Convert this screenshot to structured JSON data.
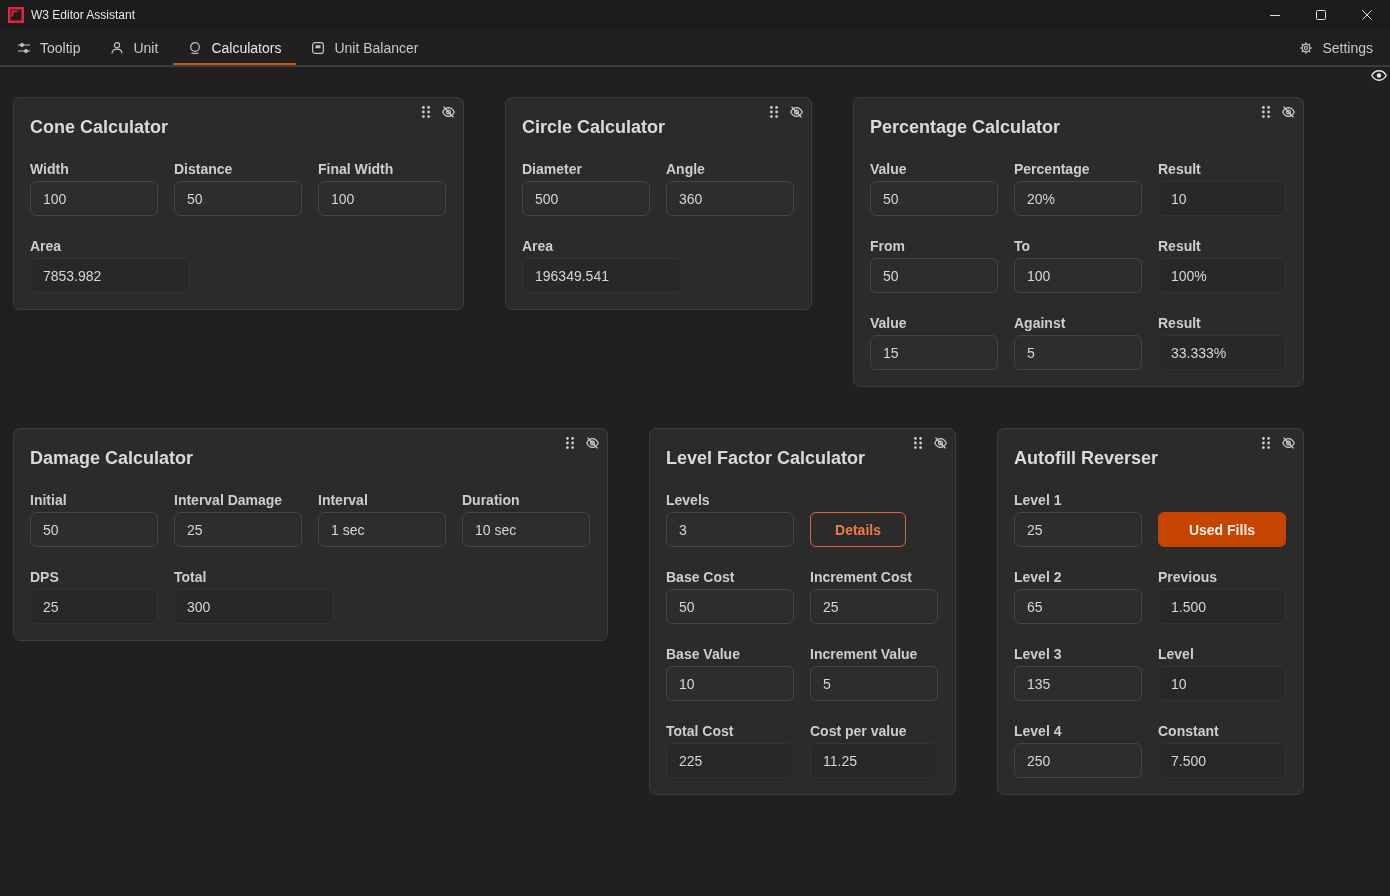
{
  "window": {
    "title": "W3 Editor Assistant"
  },
  "tabs": [
    {
      "label": "Tooltip",
      "selected": false
    },
    {
      "label": "Unit",
      "selected": false
    },
    {
      "label": "Calculators",
      "selected": true
    },
    {
      "label": "Unit Balancer",
      "selected": false
    }
  ],
  "settings": {
    "label": "Settings"
  },
  "cards": [
    {
      "title": "Cone Calculator",
      "rows": [
        [
          {
            "kind": "input",
            "label": "Width",
            "value": "100"
          },
          {
            "kind": "input",
            "label": "Distance",
            "value": "50"
          },
          {
            "kind": "input",
            "label": "Final Width",
            "value": "100"
          }
        ],
        [
          {
            "kind": "output",
            "label": "Area",
            "value": "7853.982"
          }
        ]
      ]
    },
    {
      "title": "Circle Calculator",
      "rows": [
        [
          {
            "kind": "input",
            "label": "Diameter",
            "value": "500"
          },
          {
            "kind": "input",
            "label": "Angle",
            "value": "360"
          }
        ],
        [
          {
            "kind": "output",
            "label": "Area",
            "value": "196349.541"
          }
        ]
      ]
    },
    {
      "title": "Percentage Calculator",
      "rows": [
        [
          {
            "kind": "input",
            "label": "Value",
            "value": "50"
          },
          {
            "kind": "input",
            "label": "Percentage",
            "value": "20%"
          },
          {
            "kind": "output",
            "label": "Result",
            "value": "10"
          }
        ],
        [
          {
            "kind": "input",
            "label": "From",
            "value": "50"
          },
          {
            "kind": "input",
            "label": "To",
            "value": "100"
          },
          {
            "kind": "output",
            "label": "Result",
            "value": "100%"
          }
        ],
        [
          {
            "kind": "input",
            "label": "Value",
            "value": "15"
          },
          {
            "kind": "input",
            "label": "Against",
            "value": "5"
          },
          {
            "kind": "output",
            "label": "Result",
            "value": "33.333%"
          }
        ]
      ]
    },
    {
      "title": "Damage Calculator",
      "rows": [
        [
          {
            "kind": "input",
            "label": "Initial",
            "value": "50"
          },
          {
            "kind": "input",
            "label": "Interval Damage",
            "value": "25"
          },
          {
            "kind": "input",
            "label": "Interval",
            "value": "1 sec"
          },
          {
            "kind": "input",
            "label": "Duration",
            "value": "10 sec"
          }
        ],
        [
          {
            "kind": "output",
            "label": "DPS",
            "value": "25"
          },
          {
            "kind": "output",
            "label": "Total",
            "value": "300"
          }
        ]
      ]
    },
    {
      "title": "Level Factor Calculator",
      "rows": [
        [
          {
            "kind": "input",
            "label": "Levels",
            "value": "3"
          },
          {
            "kind": "button",
            "label": "Details",
            "filled": false
          }
        ],
        [
          {
            "kind": "input",
            "label": "Base Cost",
            "value": "50"
          },
          {
            "kind": "input",
            "label": "Increment Cost",
            "value": "25"
          }
        ],
        [
          {
            "kind": "input",
            "label": "Base Value",
            "value": "10"
          },
          {
            "kind": "input",
            "label": "Increment Value",
            "value": "5"
          }
        ],
        [
          {
            "kind": "output",
            "label": "Total Cost",
            "value": "225"
          },
          {
            "kind": "output",
            "label": "Cost per value",
            "value": "11.25"
          }
        ]
      ]
    },
    {
      "title": "Autofill Reverser",
      "rows": [
        [
          {
            "kind": "input",
            "label": "Level 1",
            "value": "25"
          },
          {
            "kind": "button",
            "label": "Used Fills",
            "filled": true
          }
        ],
        [
          {
            "kind": "input",
            "label": "Level 2",
            "value": "65"
          },
          {
            "kind": "output",
            "label": "Previous",
            "value": "1.500"
          }
        ],
        [
          {
            "kind": "input",
            "label": "Level 3",
            "value": "135"
          },
          {
            "kind": "output",
            "label": "Level",
            "value": "10"
          }
        ],
        [
          {
            "kind": "input",
            "label": "Level 4",
            "value": "250"
          },
          {
            "kind": "output",
            "label": "Constant",
            "value": "7.500"
          }
        ]
      ]
    }
  ]
}
